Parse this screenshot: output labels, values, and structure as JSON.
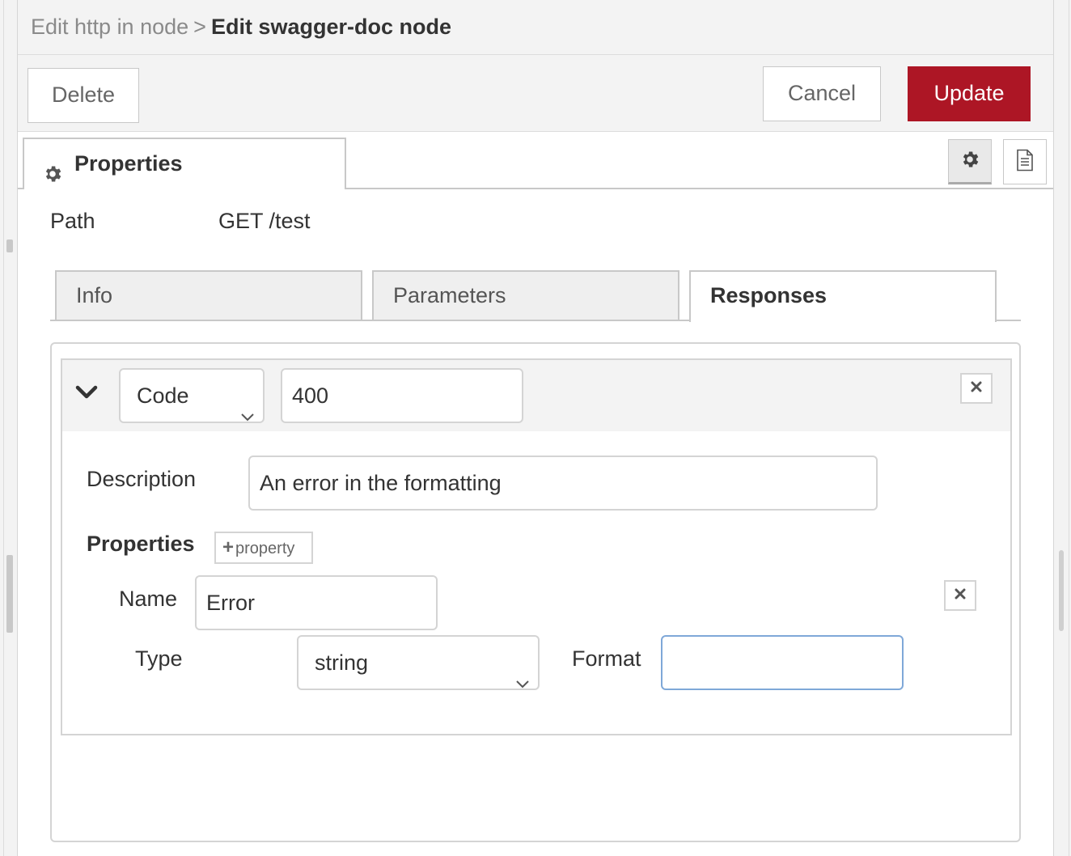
{
  "header": {
    "parent_node": "Edit http in node",
    "separator": ">",
    "current_node": "Edit swagger-doc node"
  },
  "toolbar": {
    "delete_label": "Delete",
    "cancel_label": "Cancel",
    "update_label": "Update"
  },
  "tabs": {
    "properties_label": "Properties",
    "settings_icon": "gear-icon",
    "info_icon": "document-icon"
  },
  "path": {
    "label": "Path",
    "value": "GET /test"
  },
  "subtabs": {
    "info": "Info",
    "parameters": "Parameters",
    "responses": "Responses",
    "active": "Responses"
  },
  "response": {
    "code_type": "Code",
    "code_value": "400",
    "description_label": "Description",
    "description_value": "An error in the formatting",
    "properties_label": "Properties",
    "add_property_label": "property",
    "property": {
      "name_label": "Name",
      "name_value": "Error",
      "type_label": "Type",
      "type_value": "string",
      "format_label": "Format",
      "format_value": ""
    }
  },
  "colors": {
    "accent": "#ad1625",
    "focus_border": "#7fa8d8",
    "header_bg": "#f3f3f3"
  }
}
